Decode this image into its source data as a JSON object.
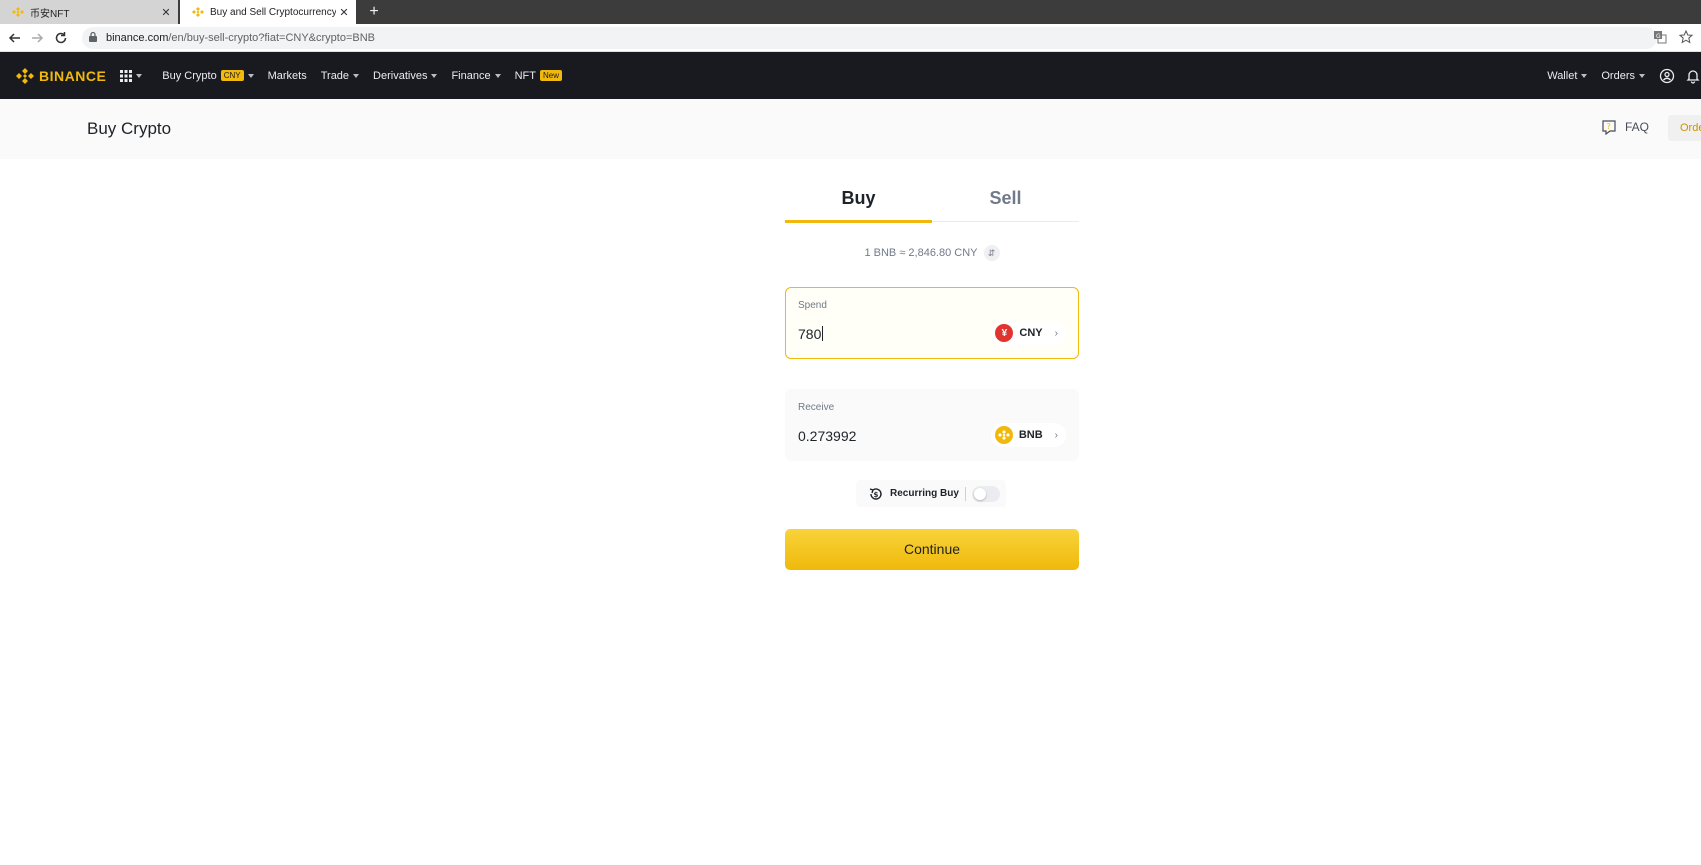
{
  "browser": {
    "tabs": [
      {
        "title": "币安NFT",
        "active": false
      },
      {
        "title": "Buy and Sell Cryptocurrency |",
        "active": true
      }
    ],
    "new_tab_symbol": "+",
    "close_symbol": "✕",
    "url_host": "binance.com",
    "url_path": "/en/buy-sell-crypto?fiat=CNY&crypto=BNB"
  },
  "header": {
    "logo_text": "BINANCE",
    "nav": [
      {
        "label": "Buy Crypto",
        "badge": "CNY"
      },
      {
        "label": "Markets"
      },
      {
        "label": "Trade"
      },
      {
        "label": "Derivatives"
      },
      {
        "label": "Finance"
      },
      {
        "label": "NFT",
        "badge": "New"
      }
    ],
    "right": [
      {
        "label": "Wallet"
      },
      {
        "label": "Orders"
      }
    ]
  },
  "subheader": {
    "title": "Buy Crypto",
    "faq_label": "FAQ",
    "orders_label": "Orders"
  },
  "trade": {
    "tab_buy": "Buy",
    "tab_sell": "Sell",
    "active_tab": "Buy",
    "rate_text": "1 BNB ≈ 2,846.80 CNY",
    "spend": {
      "label": "Spend",
      "value": "780",
      "currency": "CNY",
      "currency_symbol": "¥"
    },
    "receive": {
      "label": "Receive",
      "value": "0.273992",
      "currency": "BNB"
    },
    "recurring_label": "Recurring Buy",
    "recurring_enabled": false,
    "continue_label": "Continue"
  },
  "colors": {
    "brand_yellow": "#f0b90b",
    "header_bg": "#181a20",
    "cny_red": "#e2342e"
  }
}
